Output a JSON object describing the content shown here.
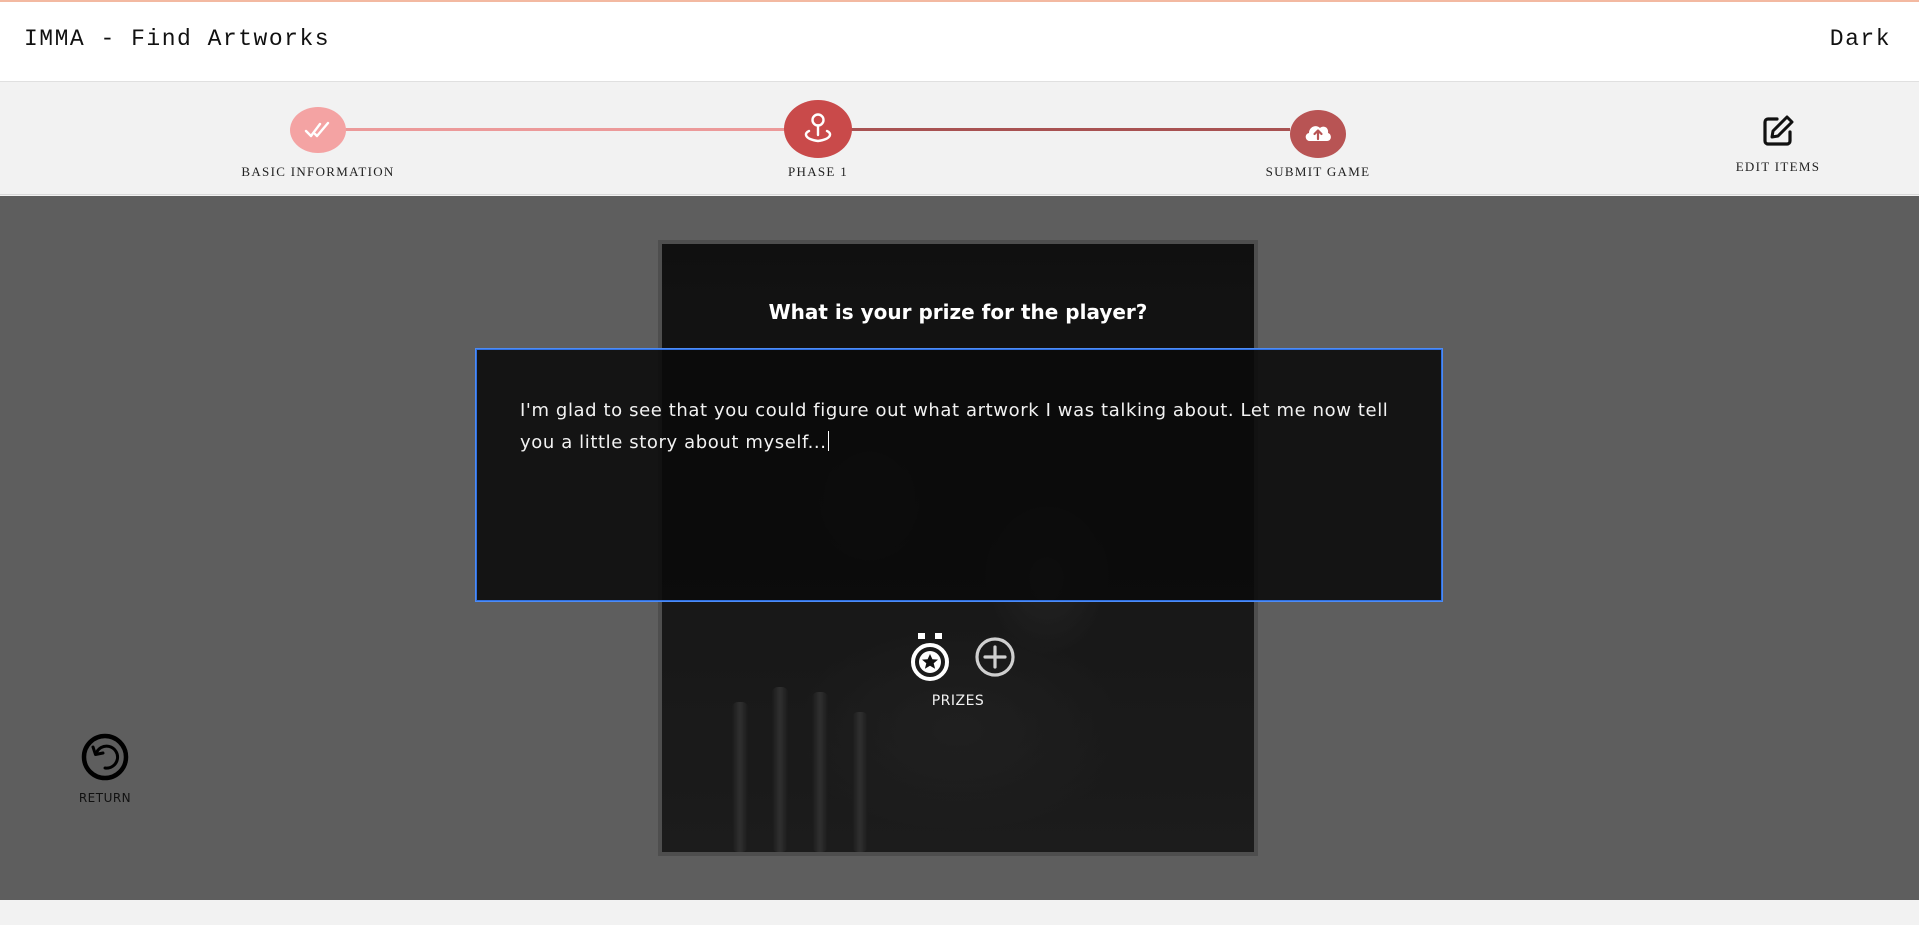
{
  "header": {
    "title": "IMMA - Find Artworks",
    "theme_toggle": "Dark"
  },
  "stepper": {
    "steps": [
      {
        "label": "BASIC INFORMATION",
        "icon": "double-check-icon",
        "state": "completed"
      },
      {
        "label": "PHASE 1",
        "icon": "location-pin-icon",
        "state": "current"
      },
      {
        "label": "SUBMIT GAME",
        "icon": "cloud-upload-icon",
        "state": "pending"
      }
    ],
    "edit_items": {
      "label": "EDIT ITEMS",
      "icon": "edit-icon"
    }
  },
  "editor": {
    "question": "What is your prize for the player?",
    "answer_text": "I'm glad to see that you could figure out what artwork I was talking about. Let me now tell you a little story about myself...",
    "prizes": {
      "label": "PRIZES",
      "medal_icon": "medal-icon",
      "add_icon": "add-circle-icon"
    }
  },
  "return_button": {
    "label": "RETURN",
    "icon": "undo-icon"
  },
  "colors": {
    "completed_step": "#f4a3a3",
    "current_step": "#c94a4a",
    "pending_step": "#b85454",
    "focus_border": "#4d8cf5",
    "backdrop": "#5e5e5e"
  }
}
